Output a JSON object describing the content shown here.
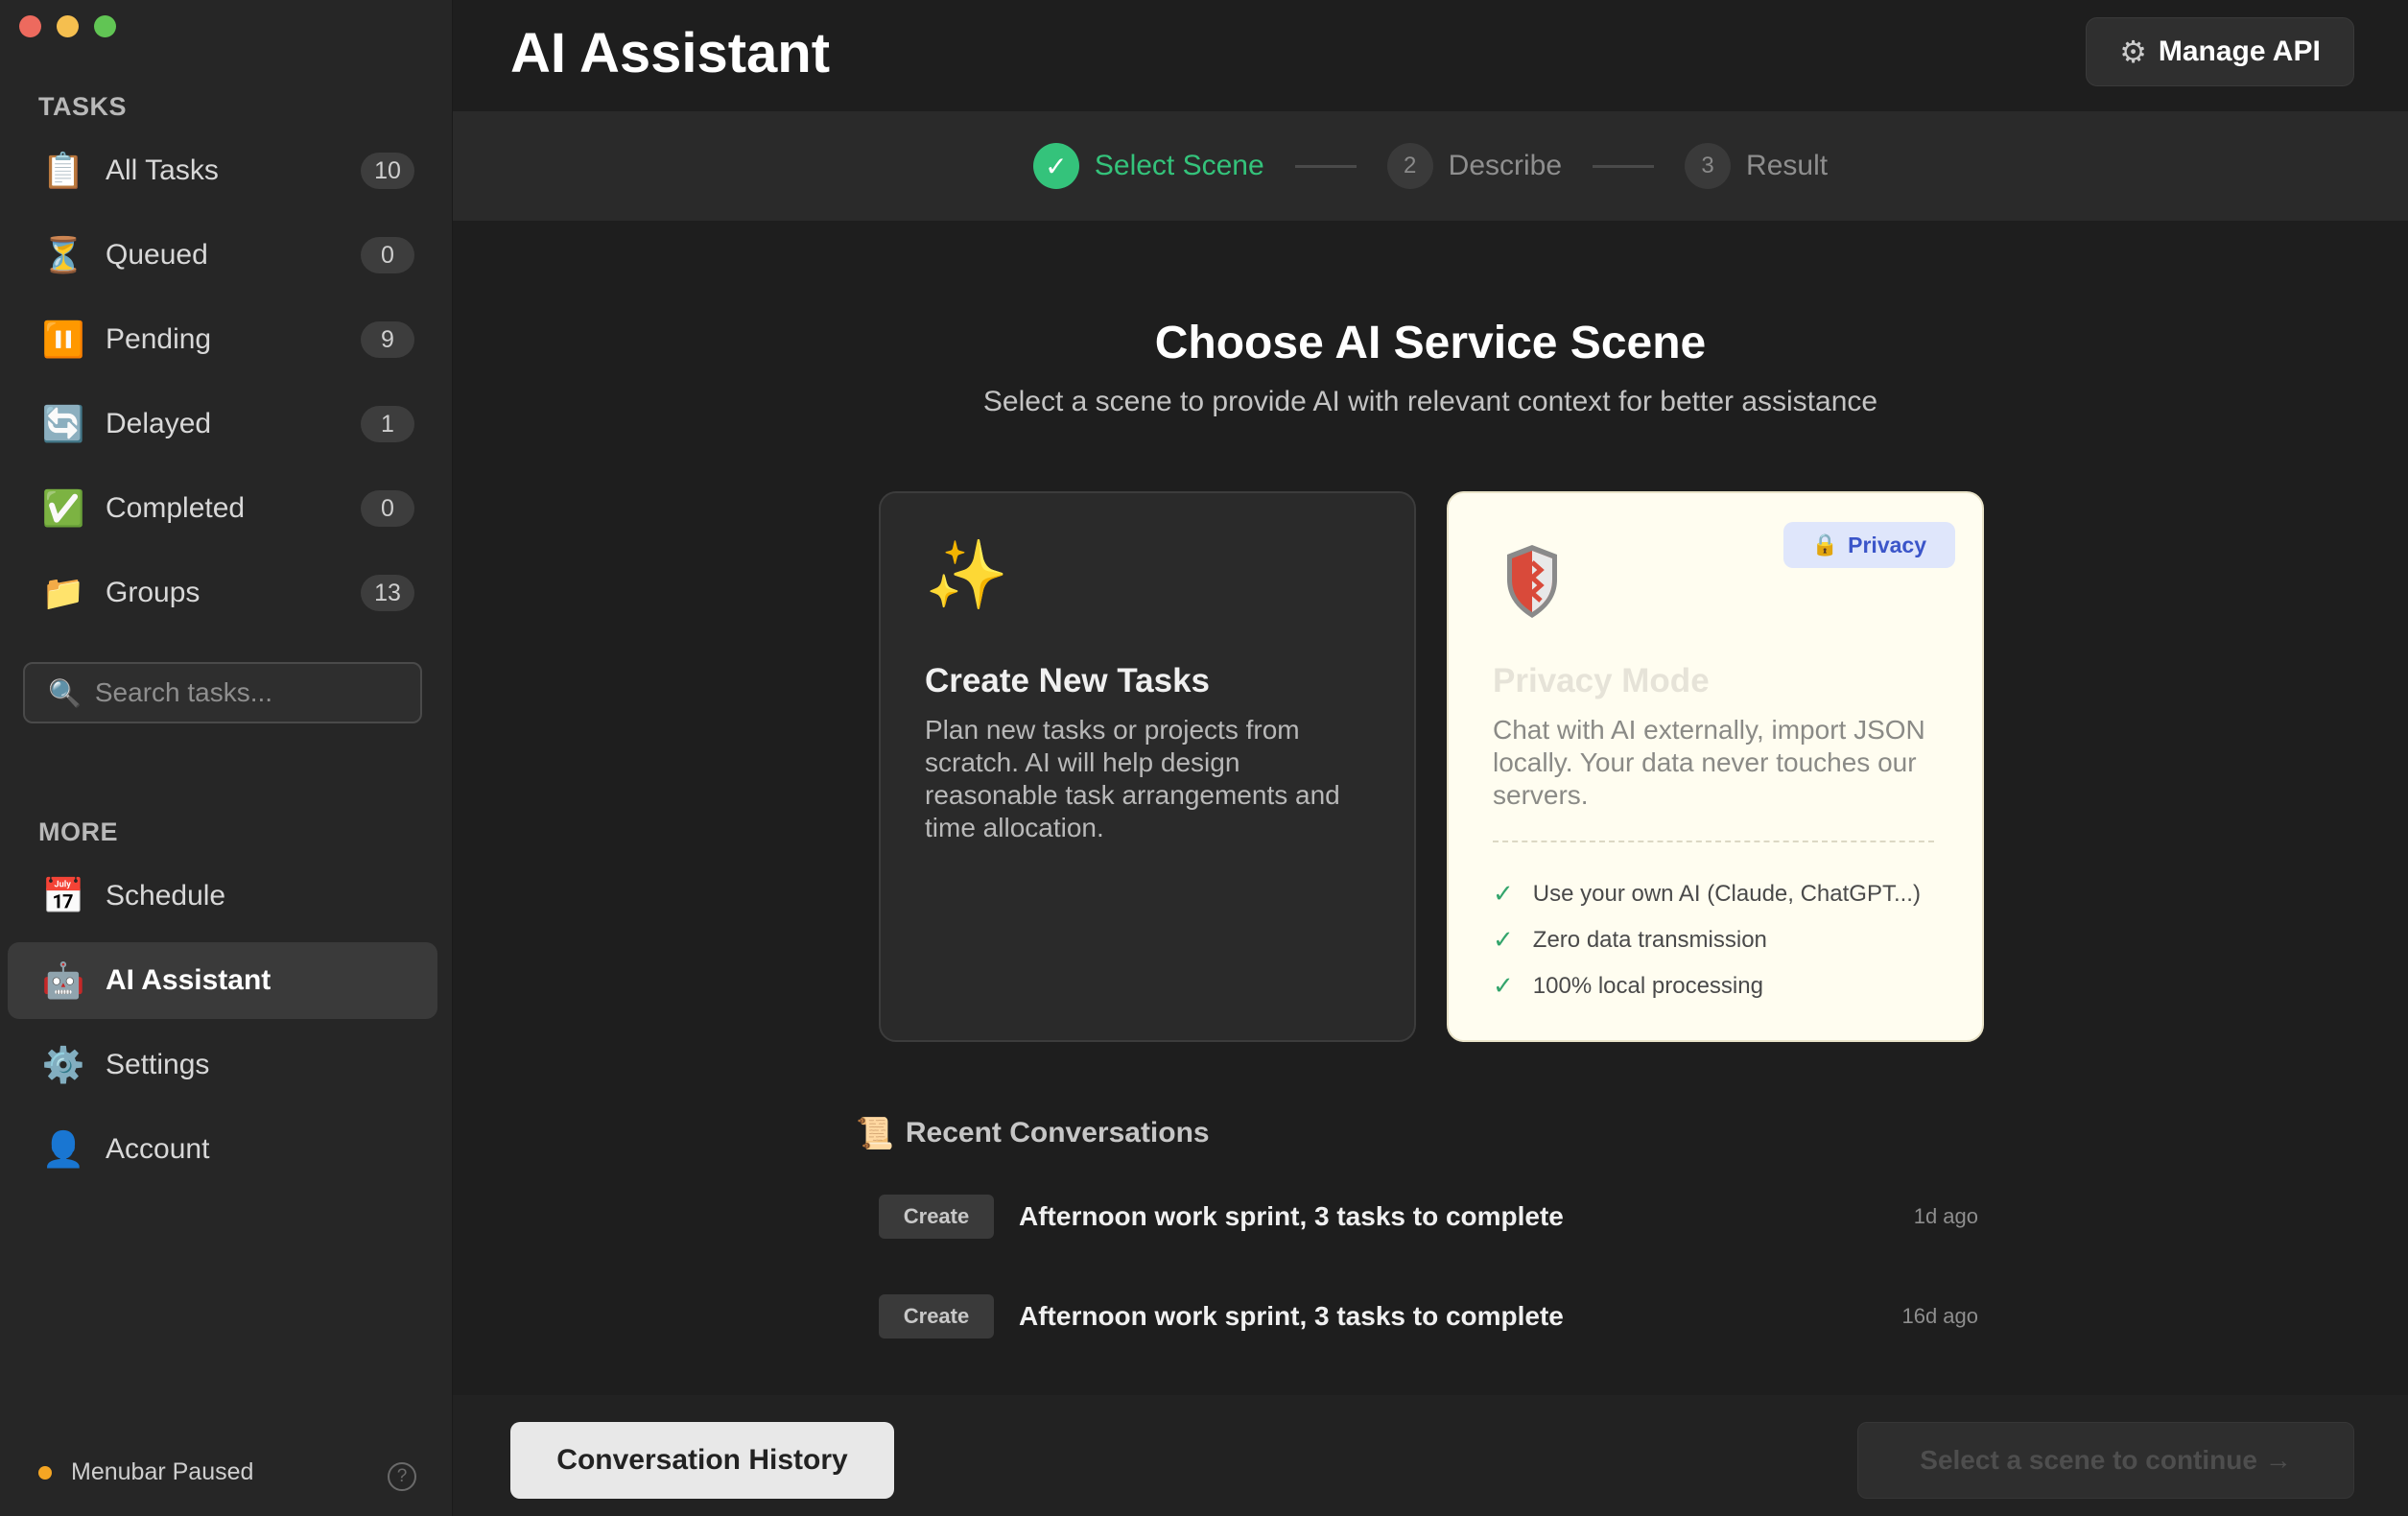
{
  "sidebar": {
    "tasks_title": "TASKS",
    "tasks": [
      {
        "label": "All Tasks",
        "icon": "clipboard-icon",
        "glyph": "📋",
        "count": "10"
      },
      {
        "label": "Queued",
        "icon": "hourglass-icon",
        "glyph": "⏳",
        "count": "0"
      },
      {
        "label": "Pending",
        "icon": "pause-icon",
        "glyph": "⏸️",
        "count": "9"
      },
      {
        "label": "Delayed",
        "icon": "repeat-icon",
        "glyph": "🔄",
        "count": "1"
      },
      {
        "label": "Completed",
        "icon": "check-icon",
        "glyph": "✅",
        "count": "0"
      },
      {
        "label": "Groups",
        "icon": "folder-icon",
        "glyph": "📁",
        "count": "13"
      }
    ],
    "search_placeholder": "Search tasks...",
    "more_title": "MORE",
    "more": [
      {
        "label": "Schedule",
        "icon": "calendar-icon",
        "glyph": "📅"
      },
      {
        "label": "AI Assistant",
        "icon": "robot-icon",
        "glyph": "🤖",
        "active": true
      },
      {
        "label": "Settings",
        "icon": "gear-icon",
        "glyph": "⚙️"
      },
      {
        "label": "Account",
        "icon": "user-icon",
        "glyph": "👤"
      }
    ],
    "status_text": "Menubar Paused",
    "status_color": "#f5a623"
  },
  "header": {
    "title": "AI Assistant",
    "manage_api_label": "Manage API"
  },
  "stepper": {
    "steps": [
      {
        "number": "✓",
        "label": "Select Scene",
        "state": "done"
      },
      {
        "number": "2",
        "label": "Describe",
        "state": "upcoming"
      },
      {
        "number": "3",
        "label": "Result",
        "state": "upcoming"
      }
    ]
  },
  "main": {
    "heading": "Choose AI Service Scene",
    "subheading": "Select a scene to provide AI with relevant context for better assistance",
    "cards": {
      "create": {
        "icon": "sparkles-icon",
        "glyph": "✨",
        "title": "Create New Tasks",
        "description": "Plan new tasks or projects from scratch. AI will help design reasonable task arrangements and time allocation."
      },
      "privacy": {
        "icon": "shield-icon",
        "badge": "Privacy",
        "title": "Privacy Mode",
        "description": "Chat with AI externally, import JSON locally. Your data never touches our servers.",
        "features": [
          "Use your own AI (Claude, ChatGPT...)",
          "Zero data transmission",
          "100% local processing"
        ]
      }
    },
    "recent_title": "Recent Conversations",
    "conversations": [
      {
        "tag": "Create",
        "title": "Afternoon work sprint, 3 tasks to complete",
        "time": "1d ago"
      },
      {
        "tag": "Create",
        "title": "Afternoon work sprint, 3 tasks to complete",
        "time": "16d ago"
      }
    ]
  },
  "footer": {
    "history_label": "Conversation History",
    "continue_label": "Select a scene to continue →"
  },
  "colors": {
    "accent_green": "#34c37b",
    "privacy_badge_bg": "#dfe6fb",
    "privacy_badge_text": "#3b55c9"
  }
}
